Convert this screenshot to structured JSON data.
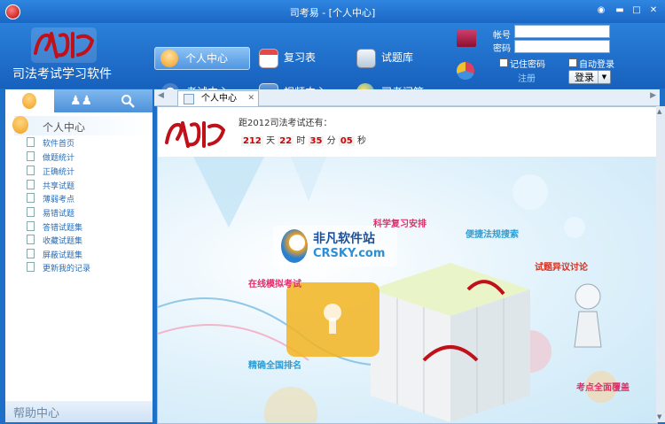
{
  "window": {
    "title": "司考易 - [个人中心]"
  },
  "app": {
    "name": "司法考试学习软件"
  },
  "nav": [
    {
      "label": "个人中心"
    },
    {
      "label": "复习表"
    },
    {
      "label": "试题库"
    },
    {
      "label": "考试中心"
    },
    {
      "label": "视频中心"
    },
    {
      "label": "司考问答"
    }
  ],
  "login": {
    "account_label": "帐号",
    "password_label": "密码",
    "remember_label": "记住密码",
    "autologin_label": "自动登录",
    "register_label": "注册",
    "login_button": "登录"
  },
  "sidebar": {
    "header": "个人中心",
    "items": [
      {
        "label": "软件首页"
      },
      {
        "label": "做题统计"
      },
      {
        "label": "正确统计"
      },
      {
        "label": "共享试题"
      },
      {
        "label": "薄弱考点"
      },
      {
        "label": "易错试题"
      },
      {
        "label": "答错试题集"
      },
      {
        "label": "收藏试题集"
      },
      {
        "label": "屏蔽试题集"
      },
      {
        "label": "更新我的记录"
      }
    ],
    "help": "帮助中心"
  },
  "tab": {
    "label": "个人中心"
  },
  "countdown": {
    "title": "距2012司法考试还有：",
    "days": "212",
    "days_unit": "天",
    "hours": "22",
    "hours_unit": "时",
    "minutes": "35",
    "minutes_unit": "分",
    "seconds": "05",
    "seconds_unit": "秒"
  },
  "hero": {
    "callouts": [
      {
        "text": "科学复习安排",
        "color": "#e0306a"
      },
      {
        "text": "便捷法规搜索",
        "color": "#2a9fd6"
      },
      {
        "text": "试题异议讨论",
        "color": "#d63020"
      },
      {
        "text": "在线模拟考试",
        "color": "#e0306a"
      },
      {
        "text": "精确全国排名",
        "color": "#2a9fd6"
      },
      {
        "text": "考点全面覆盖",
        "color": "#e0306a"
      }
    ],
    "watermark_title": "非凡软件站",
    "watermark_url": "CRSKY.com"
  },
  "colors": {
    "brand": "#1e6fc8",
    "accent_red": "#d20000"
  }
}
